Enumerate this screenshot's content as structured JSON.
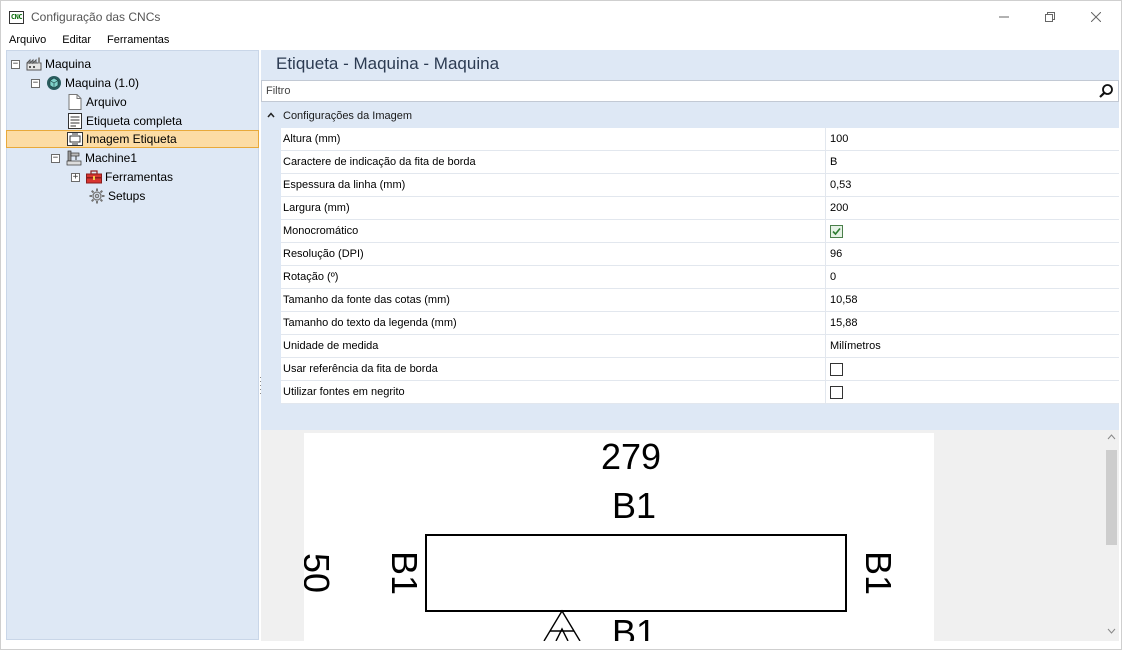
{
  "window": {
    "title": "Configuração das CNCs",
    "app_icon_text": "CNC"
  },
  "menu": [
    "Arquivo",
    "Editar",
    "Ferramentas"
  ],
  "tree": {
    "root": "Maquina",
    "machine": "Maquina (1.0)",
    "children": [
      "Arquivo",
      "Etiqueta completa",
      "Imagem Etiqueta"
    ],
    "machine1": "Machine1",
    "machine1_children": [
      "Ferramentas",
      "Setups"
    ]
  },
  "properties": {
    "title": "Etiqueta - Maquina - Maquina",
    "filter_placeholder": "Filtro",
    "category": "Configurações da Imagem",
    "rows": [
      {
        "name": "Altura (mm)",
        "value": "100"
      },
      {
        "name": "Caractere de indicação da fita de borda",
        "value": "B"
      },
      {
        "name": "Espessura da linha (mm)",
        "value": "0,53"
      },
      {
        "name": "Largura (mm)",
        "value": "200"
      },
      {
        "name": "Monocromático",
        "value": "",
        "checkbox": true,
        "checked": true
      },
      {
        "name": "Resolução (DPI)",
        "value": "96"
      },
      {
        "name": "Rotação (º)",
        "value": "0"
      },
      {
        "name": "Tamanho da fonte das cotas (mm)",
        "value": "10,58"
      },
      {
        "name": "Tamanho do texto da legenda (mm)",
        "value": "15,88"
      },
      {
        "name": "Unidade de medida",
        "value": "Milímetros"
      },
      {
        "name": "Usar referência da fita de borda",
        "value": "",
        "checkbox": true,
        "checked": false
      },
      {
        "name": "Utilizar fontes em negrito",
        "value": "",
        "checkbox": true,
        "checked": false
      }
    ]
  },
  "preview": {
    "top_dimension": "279",
    "top_edge": "B1",
    "left_dimension": "50",
    "left_edge": "B1",
    "right_edge": "B1",
    "bottom_edge": "B1"
  },
  "colors": {
    "pane_bg": "#dee8f5",
    "selected_bg": "#fcdca5",
    "selected_border": "#e8a93b"
  }
}
